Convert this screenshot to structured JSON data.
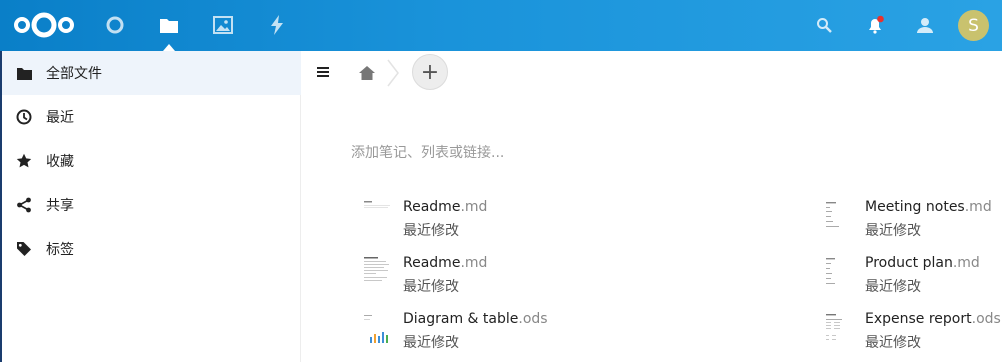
{
  "header": {
    "logo": "nextcloud-logo",
    "apps": [
      {
        "name": "dashboard",
        "icon": "circle-icon"
      },
      {
        "name": "files",
        "icon": "folder-icon",
        "active": true
      },
      {
        "name": "photos",
        "icon": "image-icon"
      },
      {
        "name": "activity",
        "icon": "lightning-icon"
      }
    ],
    "avatar_initial": "S",
    "accent_color": "#0a7fc8",
    "notification_dot_color": "#e9322d"
  },
  "sidebar": {
    "items": [
      {
        "label": "全部文件",
        "icon": "folder-icon",
        "active": true
      },
      {
        "label": "最近",
        "icon": "clock-icon"
      },
      {
        "label": "收藏",
        "icon": "star-icon"
      },
      {
        "label": "共享",
        "icon": "share-icon"
      },
      {
        "label": "标签",
        "icon": "tag-icon"
      }
    ]
  },
  "controls": {
    "add_label": "+"
  },
  "notes": {
    "placeholder": "添加笔记、列表或链接..."
  },
  "recommendations": [
    {
      "name": "Readme",
      "ext": ".md",
      "subtitle": "最近修改"
    },
    {
      "name": "Meeting notes",
      "ext": ".md",
      "subtitle": "最近修改"
    },
    {
      "name": "Readme",
      "ext": ".md",
      "subtitle": "最近修改"
    },
    {
      "name": "Product plan",
      "ext": ".md",
      "subtitle": "最近修改"
    },
    {
      "name": "Diagram & table",
      "ext": ".ods",
      "subtitle": "最近修改"
    },
    {
      "name": "Expense report",
      "ext": ".ods",
      "subtitle": "最近修改"
    }
  ]
}
